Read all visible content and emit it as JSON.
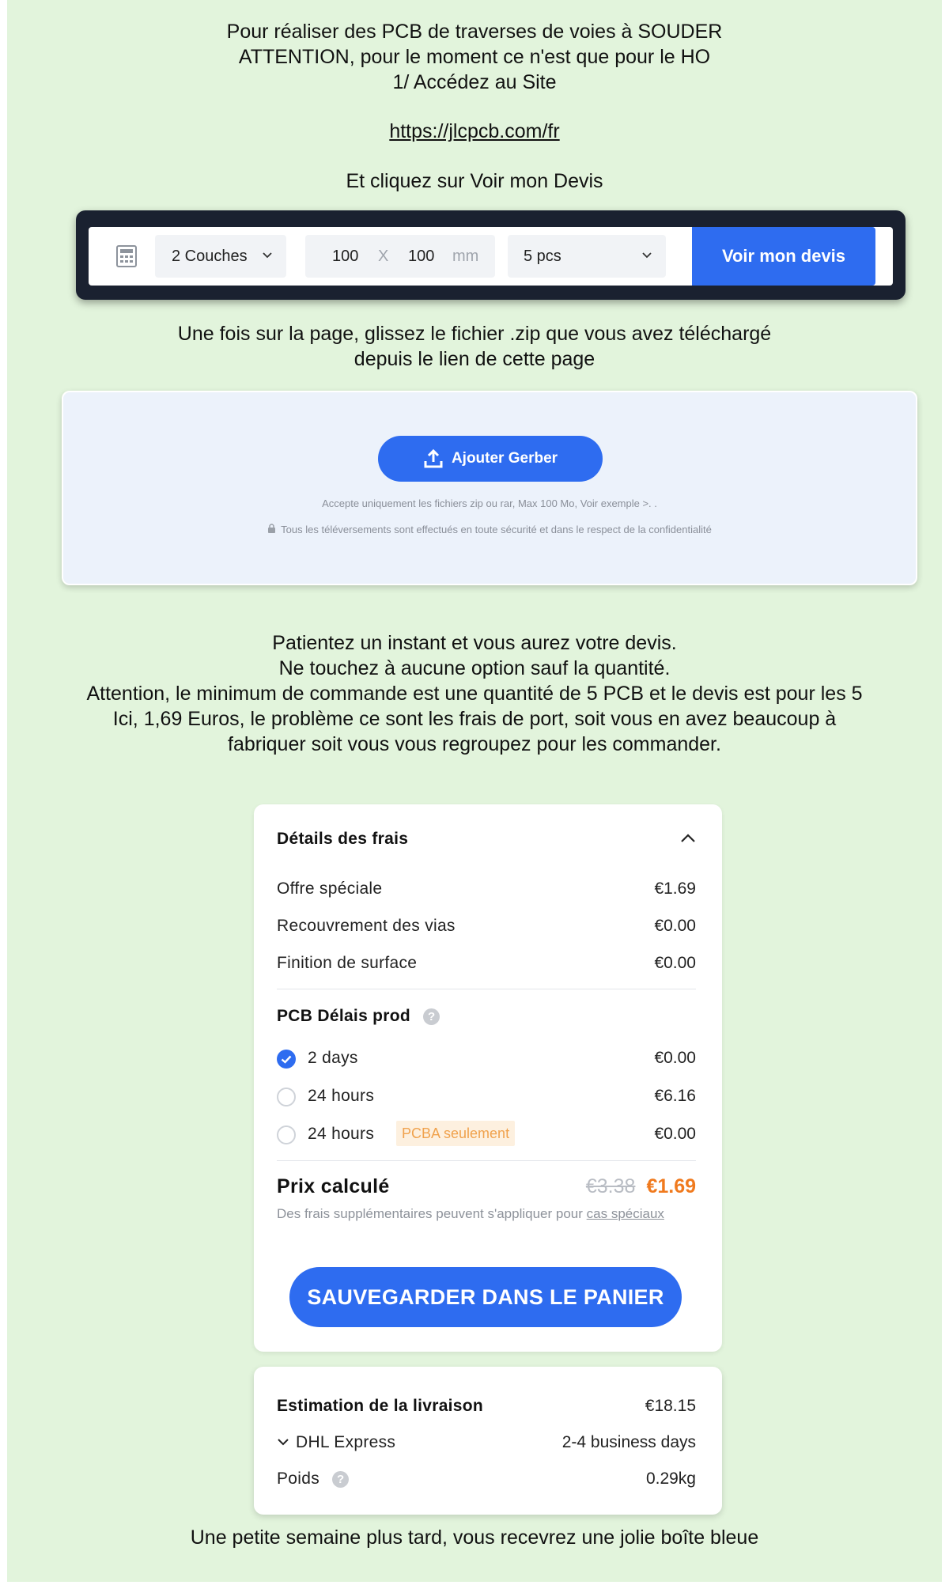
{
  "intro": {
    "line1": "Pour réaliser des PCB de traverses de voies à SOUDER",
    "line2": "ATTENTION, pour le moment ce n'est que pour le HO",
    "line3": "1/ Accédez au Site",
    "url": "https://jlcpcb.com/fr",
    "click_text": "Et cliquez sur Voir mon Devis"
  },
  "quote_bar": {
    "icon": "calculator-icon",
    "layers": "2 Couches",
    "width": "100",
    "x_sep": "X",
    "height": "100",
    "unit": "mm",
    "quantity": "5 pcs",
    "button": "Voir mon devis",
    "accent": "#2e6cf0"
  },
  "upload_text": {
    "line1": "Une fois sur la page, glissez le fichier .zip que vous avez téléchargé",
    "line2": "depuis le lien de cette page"
  },
  "upload": {
    "button": "Ajouter Gerber",
    "note": "Accepte uniquement les fichiers zip ou rar, Max 100 Mo, Voir exemple >. .",
    "security": "Tous les téléversements sont effectués en toute sécurité et dans le respect de la confidentialité"
  },
  "wait_text": {
    "line1": "Patientez un instant et vous aurez votre devis.",
    "line2": "Ne touchez à aucune option sauf la quantité.",
    "line3": "Attention, le minimum de commande est une quantité de 5 PCB et le devis est pour les 5",
    "line4": "Ici, 1,69 Euros, le problème ce sont les frais de port, soit vous en avez beaucoup à",
    "line5": "fabriquer soit vous vous regroupez pour les commander."
  },
  "fees": {
    "title": "Détails des frais",
    "items": [
      {
        "label": "Offre spéciale",
        "value": "€1.69"
      },
      {
        "label": "Recouvrement des vias",
        "value": "€0.00"
      },
      {
        "label": "Finition de surface",
        "value": "€0.00"
      }
    ],
    "lead_title": "PCB Délais prod",
    "lead_options": [
      {
        "label": "2 days",
        "value": "€0.00",
        "selected": true
      },
      {
        "label": "24 hours",
        "value": "€6.16",
        "selected": false
      },
      {
        "label": "24 hours",
        "value": "€0.00",
        "selected": false,
        "badge": "PCBA seulement"
      }
    ],
    "price_label": "Prix calculé",
    "price_old": "€3.38",
    "price_new": "€1.69",
    "price_note": "Des frais supplémentaires peuvent s'appliquer pour",
    "price_link": "cas spéciaux",
    "save_button": "SAUVEGARDER DANS LE PANIER",
    "price_color": "#f07a1e"
  },
  "shipping": {
    "title": "Estimation de la livraison",
    "cost": "€18.15",
    "carrier": "DHL Express",
    "delay": "2-4 business days",
    "weight_label": "Poids",
    "weight": "0.29kg"
  },
  "outro": "Une petite semaine plus tard, vous recevrez une jolie boîte bleue"
}
